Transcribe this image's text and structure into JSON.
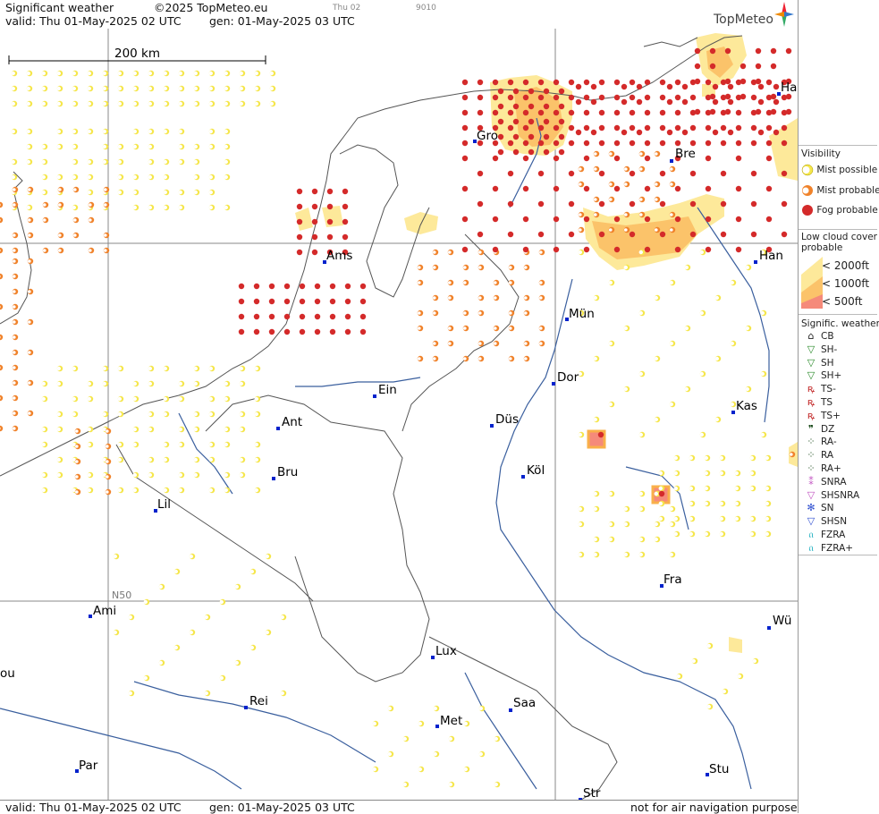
{
  "header": {
    "title": "Significant weather",
    "copyright": "©2025 TopMeteo.eu",
    "day": "Thu 02",
    "code": "9010",
    "valid": "valid:  Thu  01-May-2025  02 UTC",
    "generated": "gen: 01-May-2025 03 UTC",
    "logo": "TopMeteo"
  },
  "footer": {
    "valid": "valid:  Thu  01-May-2025  02 UTC",
    "generated": "gen: 01-May-2025 03 UTC",
    "disclaimer": "not for air navigation purposes"
  },
  "map": {
    "scale_label": "200 km",
    "lat_label": "N50",
    "colors": {
      "mist_possible": "#f5e64b",
      "mist_probable": "#f0822a",
      "fog_probable": "#d42a2a",
      "cloud_2000": "#fde99a",
      "cloud_1000": "#fbc36a",
      "cloud_500": "#f58a7a",
      "river": "#3a5f9e",
      "border": "#555555",
      "grid": "#888888"
    },
    "cities": [
      {
        "name": "Gro",
        "id": "gro"
      },
      {
        "name": "Bre",
        "id": "bre"
      },
      {
        "name": "Ha",
        "id": "ham"
      },
      {
        "name": "Ams",
        "id": "ams"
      },
      {
        "name": "Han",
        "id": "han"
      },
      {
        "name": "Mün",
        "id": "mun"
      },
      {
        "name": "Dor",
        "id": "dor"
      },
      {
        "name": "Ein",
        "id": "ein"
      },
      {
        "name": "Kas",
        "id": "kas"
      },
      {
        "name": "Ant",
        "id": "ant"
      },
      {
        "name": "Düs",
        "id": "dus"
      },
      {
        "name": "Bru",
        "id": "bru"
      },
      {
        "name": "Köl",
        "id": "kol"
      },
      {
        "name": "Lil",
        "id": "lil"
      },
      {
        "name": "Fra",
        "id": "fra"
      },
      {
        "name": "Ami",
        "id": "ami"
      },
      {
        "name": "Wü",
        "id": "wur"
      },
      {
        "name": "Lux",
        "id": "lux"
      },
      {
        "name": "ou",
        "id": "rou"
      },
      {
        "name": "Rei",
        "id": "rei"
      },
      {
        "name": "Saa",
        "id": "saa"
      },
      {
        "name": "Met",
        "id": "met"
      },
      {
        "name": "Par",
        "id": "par"
      },
      {
        "name": "Stu",
        "id": "stu"
      },
      {
        "name": "Str",
        "id": "str"
      }
    ]
  },
  "legend": {
    "visibility_title": "Visibility",
    "visibility": [
      {
        "label": "Mist possible",
        "icon": "mist-possible-icon"
      },
      {
        "label": "Mist probable",
        "icon": "mist-probable-icon"
      },
      {
        "label": "Fog probable",
        "icon": "fog-probable-icon"
      }
    ],
    "cloud_title_1": "Low cloud cover",
    "cloud_title_2": "probable",
    "cloud": [
      {
        "label": "< 2000ft"
      },
      {
        "label": "< 1000ft"
      },
      {
        "label": "<   500ft"
      }
    ],
    "weather_title": "Signific. weather",
    "weather": [
      {
        "label": "CB",
        "icon": "cb-icon"
      },
      {
        "label": "SH-",
        "icon": "shower-light-icon"
      },
      {
        "label": "SH",
        "icon": "shower-icon"
      },
      {
        "label": "SH+",
        "icon": "shower-heavy-icon"
      },
      {
        "label": "TS-",
        "icon": "thunderstorm-light-icon"
      },
      {
        "label": "TS",
        "icon": "thunderstorm-icon"
      },
      {
        "label": "TS+",
        "icon": "thunderstorm-heavy-icon"
      },
      {
        "label": "DZ",
        "icon": "drizzle-icon"
      },
      {
        "label": "RA-",
        "icon": "rain-light-icon"
      },
      {
        "label": "RA",
        "icon": "rain-icon"
      },
      {
        "label": "RA+",
        "icon": "rain-heavy-icon"
      },
      {
        "label": "SNRA",
        "icon": "snow-rain-icon"
      },
      {
        "label": "SHSNRA",
        "icon": "snow-rain-shower-icon"
      },
      {
        "label": "SN",
        "icon": "snow-icon"
      },
      {
        "label": "SHSN",
        "icon": "snow-shower-icon"
      },
      {
        "label": "FZRA",
        "icon": "freezing-rain-icon"
      },
      {
        "label": "FZRA+",
        "icon": "freezing-rain-heavy-icon"
      }
    ]
  }
}
